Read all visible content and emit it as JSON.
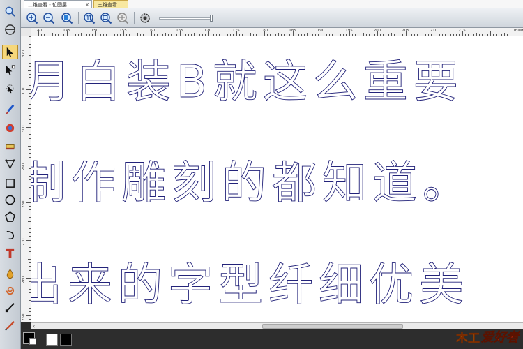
{
  "tabs": [
    {
      "label": "二维查看 - 位图层",
      "close": "×"
    },
    {
      "label": "三维查看"
    }
  ],
  "left_tools": [
    "zoom-icon",
    "globe-icon",
    "select-arrow-icon",
    "node-edit-icon",
    "transform-icon",
    "brush-icon",
    "fill-icon",
    "eraser-icon",
    "pen-icon",
    "rectangle-icon",
    "circle-icon",
    "polygon-icon",
    "arc-icon",
    "text-icon",
    "droplet-icon",
    "swirl-icon",
    "measure-icon",
    "knife-icon"
  ],
  "top_tools": [
    "zoom-in-icon",
    "zoom-out-icon",
    "zoom-fit-icon",
    "zoom-1to1-icon",
    "zoom-window-icon",
    "pan-icon",
    "settings-icon"
  ],
  "ruler": {
    "h_labels": [
      "140",
      "145",
      "150",
      "155",
      "160",
      "165",
      "170",
      "175",
      "180",
      "185",
      "190",
      "195",
      "200",
      "205",
      "210",
      "215"
    ],
    "unit": "millime",
    "v_labels": [
      "320",
      "310",
      "300",
      "290",
      "280",
      "270",
      "260",
      "250"
    ]
  },
  "canvas": {
    "line1": "月白装B就这么重要",
    "line2": "制作雕刻的都知道。",
    "line3": "出来的字型纤细优美"
  },
  "scroll": {
    "left_arrow": "‹"
  },
  "colors": {
    "foreground": "#000000",
    "background": "#ffffff",
    "stroke": "#23237a"
  },
  "logo": {
    "mark": "木工",
    "word": "爱好者"
  }
}
